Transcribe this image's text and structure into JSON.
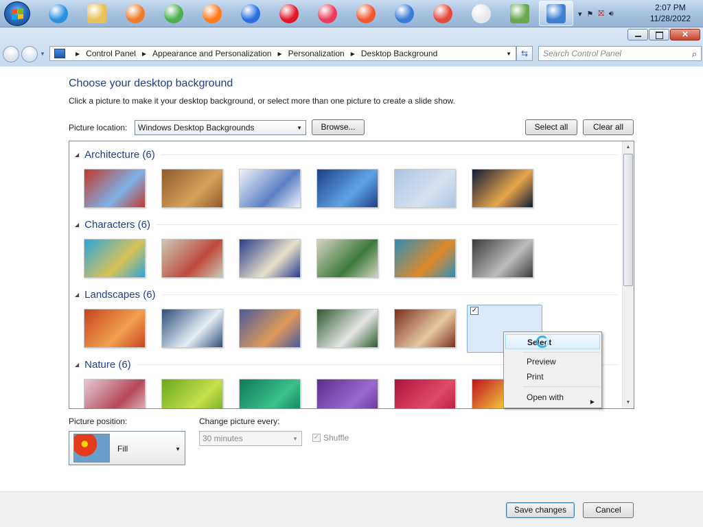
{
  "taskbar": {
    "start_label": "Start",
    "pinned": [
      {
        "name": "internet-explorer-icon",
        "color": "#2b8fe0"
      },
      {
        "name": "file-explorer-icon",
        "color": "#e8c15a"
      },
      {
        "name": "media-player-icon",
        "color": "#f07b2a"
      },
      {
        "name": "chrome-icon",
        "color": "#4caf50"
      },
      {
        "name": "firefox-icon",
        "color": "#ff7a1a"
      },
      {
        "name": "firefox-blue-icon",
        "color": "#2a6fe0"
      },
      {
        "name": "opera-icon",
        "color": "#e0172a"
      },
      {
        "name": "opera-gx-icon",
        "color": "#ea3b5a"
      },
      {
        "name": "brave-icon",
        "color": "#f2572a"
      },
      {
        "name": "thunderbird-icon",
        "color": "#3a7bd5"
      },
      {
        "name": "vivaldi-icon",
        "color": "#e24a3c"
      },
      {
        "name": "blank-circle-icon",
        "color": "#e6e9ee"
      },
      {
        "name": "winrar-icon",
        "color": "#6aa84f"
      },
      {
        "name": "control-panel-icon",
        "color": "#3f7fd0"
      }
    ],
    "clock_time": "2:07 PM",
    "clock_date": "11/28/2022"
  },
  "window": {
    "close_glyph": "✕",
    "breadcrumbs": [
      "Control Panel",
      "Appearance and Personalization",
      "Personalization",
      "Desktop Background"
    ],
    "search_placeholder": "Search Control Panel"
  },
  "page": {
    "title": "Choose your desktop background",
    "description": "Click a picture to make it your desktop background, or select more than one picture to create a slide show.",
    "picture_location_label": "Picture location:",
    "picture_location_value": "Windows Desktop Backgrounds",
    "browse_label": "Browse...",
    "select_all_label": "Select all",
    "clear_all_label": "Clear all"
  },
  "groups": [
    {
      "name": "Architecture (6)",
      "colors": [
        [
          "#c0392b",
          "#7fb2e8"
        ],
        [
          "#8e5a2c",
          "#d6a25a"
        ],
        [
          "#f0f4fb",
          "#5b7fc4"
        ],
        [
          "#1e3f86",
          "#5fa3e7"
        ],
        [
          "#a9c3e3",
          "#d8e2ee"
        ],
        [
          "#0f1b3a",
          "#e8a64a"
        ]
      ]
    },
    {
      "name": "Characters (6)",
      "colors": [
        [
          "#2aa7d9",
          "#d9c257"
        ],
        [
          "#c9c9b8",
          "#c04a3a"
        ],
        [
          "#2b3a8e",
          "#e8e2c9"
        ],
        [
          "#d7d2c4",
          "#3b7a3a"
        ],
        [
          "#2b8fb8",
          "#e08a2a"
        ],
        [
          "#3a3a3a",
          "#bdbdbd"
        ]
      ]
    },
    {
      "name": "Landscapes (6)",
      "colors": [
        [
          "#c6441e",
          "#f0a050"
        ],
        [
          "#2e4e7a",
          "#e6eef6"
        ],
        [
          "#4a5a9a",
          "#e09a5a"
        ],
        [
          "#2e5a2e",
          "#e6e6e6"
        ],
        [
          "#7a2e1e",
          "#e8c9a0"
        ],
        [
          "#7a6aa8",
          "#e6e2f4"
        ]
      ]
    },
    {
      "name": "Nature (6)",
      "colors": [
        [
          "#e6c9d4",
          "#b4485a"
        ],
        [
          "#6aa81e",
          "#c6e04a"
        ],
        [
          "#0e7a5a",
          "#3ac08a"
        ],
        [
          "#5a2e8a",
          "#9a6ad0"
        ],
        [
          "#b0123a",
          "#e04a6a"
        ],
        [
          "#c0121e",
          "#f0c040"
        ]
      ]
    }
  ],
  "context_menu": {
    "items": [
      "Select",
      "Preview",
      "Print",
      "Open with"
    ],
    "highlighted": "Select"
  },
  "settings": {
    "picture_position_label": "Picture position:",
    "picture_position_value": "Fill",
    "change_every_label": "Change picture every:",
    "change_every_value": "30 minutes",
    "shuffle_label": "Shuffle",
    "shuffle_checked": true
  },
  "footer": {
    "save_label": "Save changes",
    "cancel_label": "Cancel"
  }
}
